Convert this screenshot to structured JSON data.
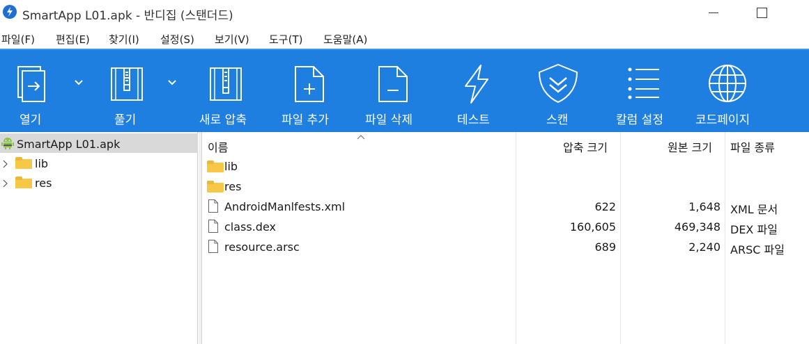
{
  "window": {
    "title": "SmartApp L01.apk - 반디집 (스탠더드)",
    "accent_color": "#1e7fe0"
  },
  "menu": [
    {
      "label": "파일(F)"
    },
    {
      "label": "편집(E)"
    },
    {
      "label": "찾기(I)"
    },
    {
      "label": "설정(S)"
    },
    {
      "label": "보기(V)"
    },
    {
      "label": "도구(T)"
    },
    {
      "label": "도움말(A)"
    }
  ],
  "toolbar": {
    "open": {
      "label": "열기",
      "icon": "open-archive-icon"
    },
    "extract": {
      "label": "풀기",
      "icon": "extract-zip-icon"
    },
    "new": {
      "label": "새로 압축",
      "icon": "new-archive-icon"
    },
    "add": {
      "label": "파일 추가",
      "icon": "add-file-icon"
    },
    "delete": {
      "label": "파일 삭제",
      "icon": "delete-file-icon"
    },
    "test": {
      "label": "테스트",
      "icon": "lightning-icon"
    },
    "scan": {
      "label": "스캔",
      "icon": "shield-icon"
    },
    "columns": {
      "label": "칼럼 설정",
      "icon": "list-icon"
    },
    "codepage": {
      "label": "코드페이지",
      "icon": "globe-icon"
    }
  },
  "tree": {
    "root": {
      "label": "SmartApp L01.apk",
      "icon": "android-icon"
    },
    "nodes": [
      {
        "label": "lib"
      },
      {
        "label": "res"
      }
    ]
  },
  "filelist": {
    "columns": {
      "name": "이름",
      "packed": "압축 크기",
      "original": "원본 크기",
      "type": "파일 종류"
    },
    "rows": [
      {
        "name": "lib",
        "kind": "folder",
        "packed": "",
        "original": "",
        "type": ""
      },
      {
        "name": "res",
        "kind": "folder",
        "packed": "",
        "original": "",
        "type": ""
      },
      {
        "name": "AndroidManlfests.xml",
        "kind": "file",
        "packed": "622",
        "original": "1,648",
        "type": "XML 문서"
      },
      {
        "name": "class.dex",
        "kind": "file",
        "packed": "160,605",
        "original": "469,348",
        "type": "DEX 파일"
      },
      {
        "name": "resource.arsc",
        "kind": "file",
        "packed": "689",
        "original": "2,240",
        "type": "ARSC 파일"
      }
    ]
  }
}
